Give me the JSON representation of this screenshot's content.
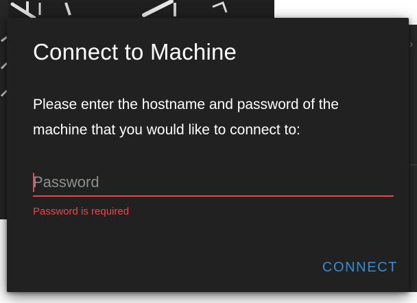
{
  "dialog": {
    "title": "Connect to Machine",
    "message": "Please enter the hostname and password of the machine that you would like to connect to:",
    "password_field": {
      "value": "",
      "placeholder": "Password",
      "error": "Password is required"
    },
    "connect_label": "CONNECT"
  },
  "colors": {
    "dialog_background": "#212121",
    "error": "#e5484d",
    "accent": "#2f8fdc",
    "text": "#ffffff",
    "placeholder": "#8f8f8f"
  }
}
